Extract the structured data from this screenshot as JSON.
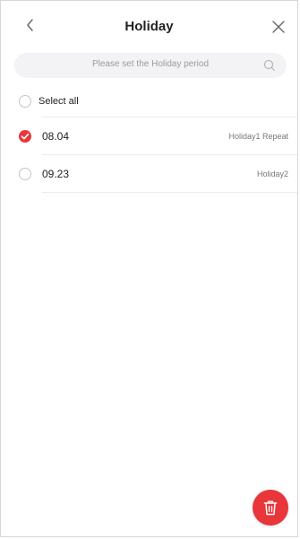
{
  "header": {
    "title": "Holiday",
    "back_icon": "chevron-left-icon",
    "close_icon": "close-icon"
  },
  "search": {
    "placeholder": "Please set the Holiday period",
    "icon": "search-icon"
  },
  "list": {
    "select_all_label": "Select all",
    "items": [
      {
        "date": "08.04",
        "tag": "Holiday1 Repeat",
        "checked": true
      },
      {
        "date": "09.23",
        "tag": "Holiday2",
        "checked": false
      }
    ]
  },
  "fab": {
    "icon": "trash-icon"
  },
  "colors": {
    "accent": "#e8363a",
    "divider": "#ececec",
    "search_bg": "#f3f3f5"
  }
}
